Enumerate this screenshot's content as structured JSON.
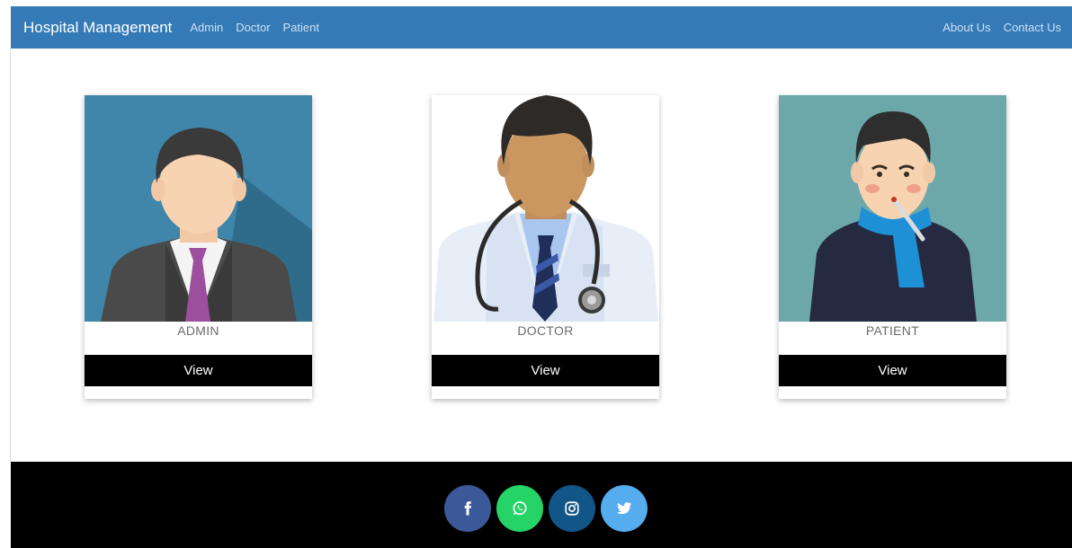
{
  "navbar": {
    "brand": "Hospital Management",
    "left_links": [
      "Admin",
      "Doctor",
      "Patient"
    ],
    "right_links": [
      "About Us",
      "Contact Us"
    ],
    "background": "#337ab7"
  },
  "cards": [
    {
      "label": "ADMIN",
      "button": "View",
      "image": "admin-avatar"
    },
    {
      "label": "DOCTOR",
      "button": "View",
      "image": "doctor-avatar"
    },
    {
      "label": "PATIENT",
      "button": "View",
      "image": "patient-avatar"
    }
  ],
  "footer": {
    "background": "#000000",
    "social": [
      {
        "icon": "facebook-icon",
        "color": "#3b5998"
      },
      {
        "icon": "whatsapp-icon",
        "color": "#25d366"
      },
      {
        "icon": "instagram-icon",
        "color": "#125688"
      },
      {
        "icon": "twitter-icon",
        "color": "#55acee"
      }
    ]
  }
}
